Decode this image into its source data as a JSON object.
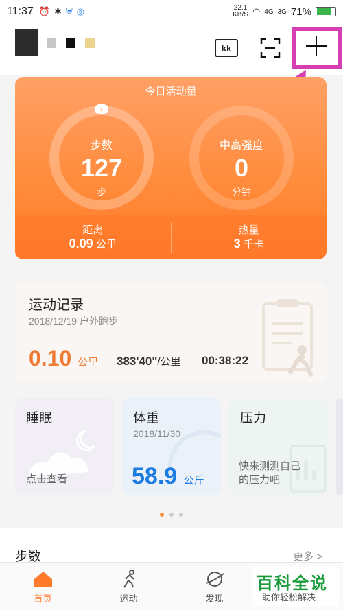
{
  "statusbar": {
    "time": "11:37",
    "speed_top": "22.1",
    "speed_bottom": "KB/S",
    "net1": "4G",
    "net2": "3G",
    "battery": "71%",
    "battery_level": 0.71
  },
  "header": {
    "kk_label": "kk"
  },
  "activity": {
    "title": "今日活动量",
    "steps": {
      "label": "步数",
      "value": "127",
      "unit": "步"
    },
    "intensity": {
      "label": "中高强度",
      "value": "0",
      "unit": "分钟"
    },
    "distance": {
      "label": "距离",
      "value": "0.09",
      "unit": "公里"
    },
    "calories": {
      "label": "热量",
      "value": "3",
      "unit": "千卡"
    }
  },
  "record": {
    "title": "运动记录",
    "subtitle": "2018/12/19  户外跑步",
    "distance": "0.10",
    "distance_unit": "公里",
    "pace": "383'40\"",
    "pace_unit": "/公里",
    "duration": "00:38:22"
  },
  "sleep": {
    "title": "睡眠",
    "footer": "点击查看"
  },
  "weight": {
    "title": "体重",
    "date": "2018/11/30",
    "value": "58.9",
    "unit": "公斤"
  },
  "stress": {
    "title": "压力",
    "footer_line1": "快来测测自己",
    "footer_line2": "的压力吧"
  },
  "steps_section": {
    "title": "步数",
    "more": "更多 >"
  },
  "tabs": [
    {
      "label": "首页"
    },
    {
      "label": "运动"
    },
    {
      "label": "发现"
    }
  ],
  "watermark": {
    "line1": "百科全说",
    "line2": "助你轻松解决"
  },
  "colors": {
    "accent": "#ff8a3a",
    "highlight": "#d63fb4",
    "weight_blue": "#1a7be0"
  }
}
